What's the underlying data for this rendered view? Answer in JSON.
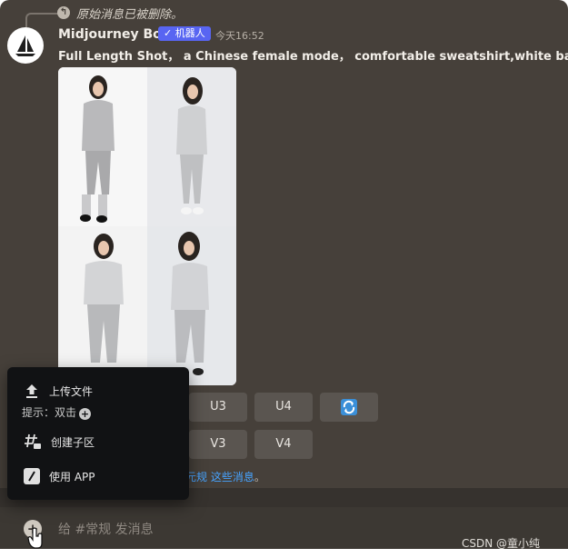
{
  "reply": {
    "text": "原始消息已被删除。"
  },
  "message": {
    "author": "Midjourney Bot",
    "badge": "✓ 机器人",
    "timestamp": "今天16:52",
    "prompt": "Full Length Shot， a Chinese female mode， comfortable sweatshirt,white back"
  },
  "buttons": {
    "row1": [
      "U3",
      "U4"
    ],
    "row2": [
      "V3",
      "V4"
    ],
    "refresh_icon": "refresh-icon"
  },
  "notice": {
    "prefix": "元规",
    "link": "这些消息",
    "suffix": "。"
  },
  "popup": {
    "upload_label": "上传文件",
    "hint_label": "提示：双击",
    "thread_label": "创建子区",
    "app_label": "使用 APP"
  },
  "composer": {
    "placeholder": "给 #常规 发消息"
  },
  "watermark": "CSDN @童小纯",
  "colors": {
    "accent": "#5865f2",
    "link": "#47a3ff",
    "chat_bg": "#46403a"
  }
}
